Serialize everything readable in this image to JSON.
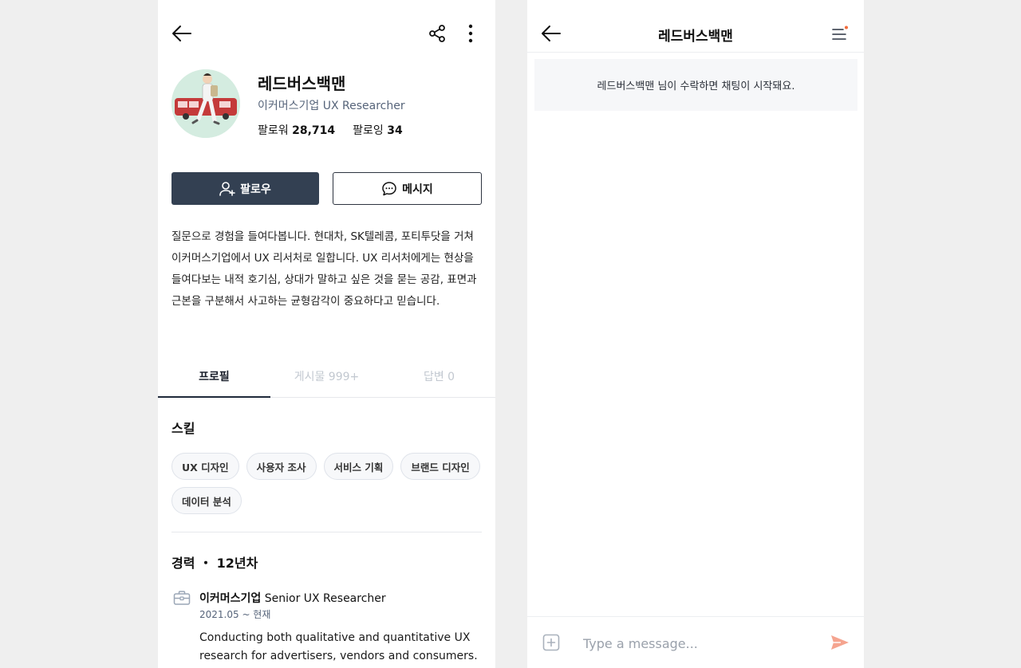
{
  "profile": {
    "name": "레드버스백맨",
    "title": "이커머스기업 UX Researcher",
    "followers_label": "팔로워",
    "followers_count": "28,714",
    "following_label": "팔로잉",
    "following_count": "34",
    "follow_button": "팔로우",
    "message_button": "메시지",
    "bio": "질문으로 경험을 들여다봅니다. 현대차, SK텔레콤, 포티투닷을 거쳐 이커머스기업에서 UX 리서처로 일합니다. UX 리서처에게는 현상을 들여다보는 내적 호기심, 상대가 말하고 싶은 것을 묻는 공감, 표면과 근본을 구분해서 사고하는 균형감각이 중요하다고 믿습니다.",
    "tabs": [
      {
        "label": "프로필",
        "active": true
      },
      {
        "label": "게시물 999+",
        "active": false
      },
      {
        "label": "답변 0",
        "active": false
      }
    ],
    "skills_title": "스킬",
    "skills": [
      "UX 디자인",
      "사용자 조사",
      "서비스 기획",
      "브랜드 디자인",
      "데이터 분석"
    ],
    "career_title": "경력 ・ 12년차",
    "career": {
      "company": "이커머스기업",
      "role": "Senior UX Researcher",
      "period": "2021.05 ~ 현재",
      "description": "Conducting both qualitative and quantitative UX research for advertisers, vendors and consumers."
    },
    "icons": {
      "back": "arrow-left-icon",
      "share": "share-icon",
      "more": "more-vertical-icon",
      "follow": "user-plus-icon",
      "message": "chat-bubble-icon",
      "career": "briefcase-icon"
    }
  },
  "chat": {
    "title": "레드버스백맨",
    "notice": "레드버스백맨 님이 수락하면 채팅이 시작돼요.",
    "input_placeholder": "Type a message...",
    "icons": {
      "back": "arrow-left-icon",
      "menu": "menu-icon",
      "add": "plus-square-icon",
      "send": "send-icon"
    },
    "colors": {
      "menu_dot": "#f26b3a",
      "send": "#f5a48f"
    }
  },
  "colors": {
    "primary_button": "#334052",
    "muted_text": "#56647a"
  }
}
